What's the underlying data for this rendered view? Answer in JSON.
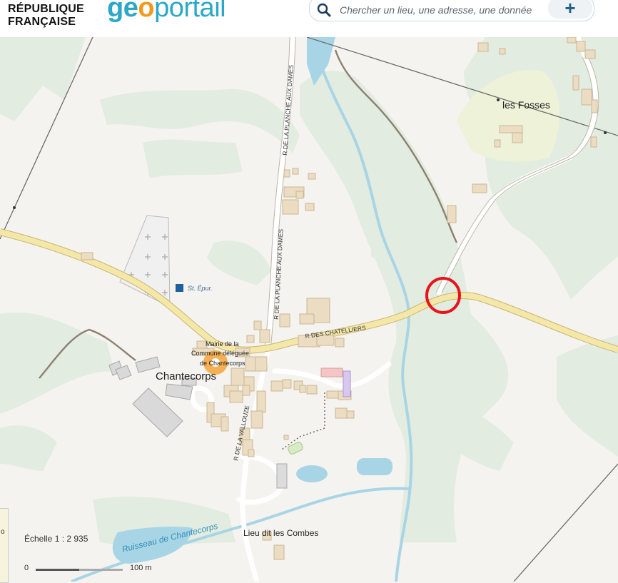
{
  "header": {
    "republique_line1": "RÉPUBLIQUE",
    "republique_line2": "FRANÇAISE",
    "logo_part1": "ge",
    "logo_part2": "o",
    "logo_part3": "portail",
    "search_placeholder": "Chercher un lieu, une adresse, une donnée",
    "plus_label": "+"
  },
  "map": {
    "places": {
      "chantecorps": "Chantecorps",
      "les_fosses": "les Fosses",
      "lieu_dit": "Lieu dit les Combes",
      "st_epur": "St. Épur.",
      "mairie_line1": "Mairie de la",
      "mairie_line2": "Commune déléguée",
      "mairie_line3": "de Chantecorps"
    },
    "roads": {
      "planche_north": "R DE LA PLANCHE AUX DAMES",
      "planche_south": "R DE LA PLANCHE AUX DAMES",
      "chatelliers": "R DES CHATELLIERS",
      "vallouze": "R DE LA VALLOUZE"
    },
    "water": {
      "ruisseau": "Ruisseau de Chantecorps"
    },
    "colors": {
      "background": "#f5f3ef",
      "forest": "#e3ece0",
      "road_main": "#f4e7a8",
      "water": "#a8d5e5",
      "building": "#ecdcc1",
      "marker_circle": "#e8141c",
      "mairie_marker": "#f2a33a"
    }
  },
  "scale": {
    "label": "Échelle 1 :  2 935",
    "start": "0",
    "end": "100 m"
  },
  "left_panel": {
    "glyph": "o"
  }
}
